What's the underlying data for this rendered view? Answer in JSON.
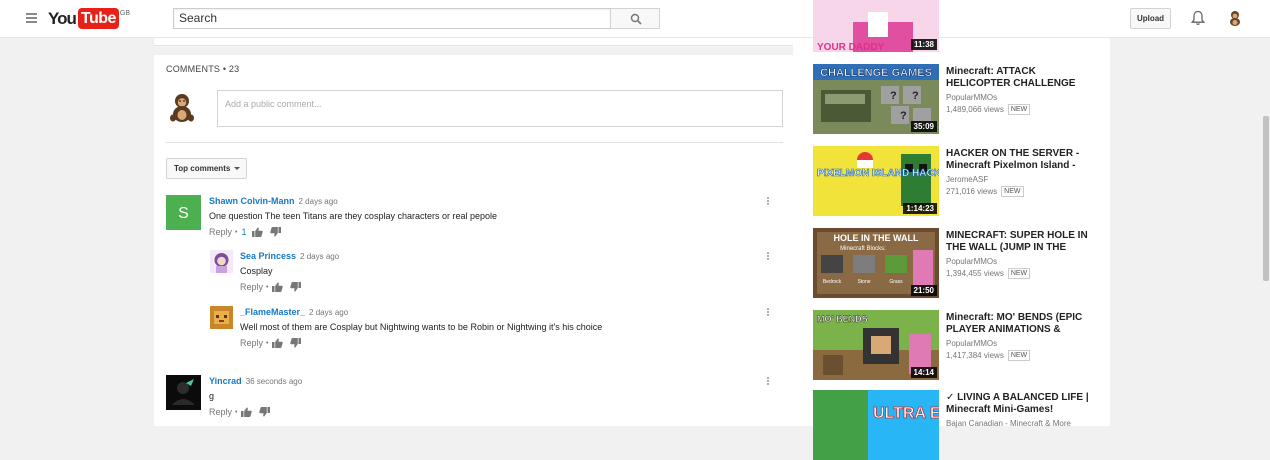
{
  "header": {
    "logo_you": "You",
    "logo_tube": "Tube",
    "region": "GB",
    "search_placeholder": "Search",
    "upload_label": "Upload"
  },
  "comments": {
    "heading": "COMMENTS",
    "count": "• 23",
    "input_placeholder": "Add a public comment...",
    "sort_label": "Top comments",
    "items": [
      {
        "author": "Shawn Colvin-Mann",
        "time": "2 days ago",
        "text": "One question The teen Titans are they cosplay characters or real pepole",
        "reply_label": "Reply",
        "likes": "1",
        "avatar_letter": "S",
        "avatar_color": "#4caf50"
      },
      {
        "author": "Sea Princess",
        "time": "2 days ago",
        "text": "Cosplay",
        "reply_label": "Reply"
      },
      {
        "author": "_FlameMaster_",
        "time": "2 days ago",
        "text": "Well most of them are Cosplay but Nightwing wants to be Robin or Nightwing it's his choice",
        "reply_label": "Reply"
      },
      {
        "author": "Yincrad",
        "time": "36 seconds ago",
        "text": "g",
        "reply_label": "Reply"
      }
    ]
  },
  "sidebar": {
    "videos": [
      {
        "title": "",
        "channel": "",
        "views": "",
        "duration": "11:38",
        "thumb_text": "YOUR DADDY"
      },
      {
        "title": "Minecraft: ATTACK HELICOPTER CHALLENGE",
        "channel": "PopularMMOs",
        "views": "1,489,066 views",
        "badge": "NEW",
        "duration": "35:09",
        "thumb_text": "CHALLENGE GAMES"
      },
      {
        "title": "HACKER ON THE SERVER - Minecraft Pixelmon Island -",
        "channel": "JeromeASF",
        "views": "271,016 views",
        "badge": "NEW",
        "duration": "1:14:23",
        "thumb_text": "PIXELMON ISLAND HACKER!?"
      },
      {
        "title": "MINECRAFT: SUPER HOLE IN THE WALL (JUMP IN THE",
        "channel": "PopularMMOs",
        "views": "1,394,455 views",
        "badge": "NEW",
        "duration": "21:50",
        "thumb_text": "HOLE IN THE WALL",
        "thumb_sub": "Minecraft Blocks:",
        "thumb_labels": [
          "Bedrock",
          "Stone",
          "Grass"
        ]
      },
      {
        "title": "Minecraft: MO' BENDS (EPIC PLAYER ANIMATIONS &",
        "channel": "PopularMMOs",
        "views": "1,417,384 views",
        "badge": "NEW",
        "duration": "14:14",
        "thumb_text": "MO' BENDS"
      },
      {
        "title": "✓ LIVING A BALANCED LIFE | Minecraft Mini-Games!",
        "channel": "Bajan Canadian - Minecraft & More",
        "views": "",
        "duration": "",
        "thumb_text": "ULTRA EPIC"
      }
    ]
  }
}
